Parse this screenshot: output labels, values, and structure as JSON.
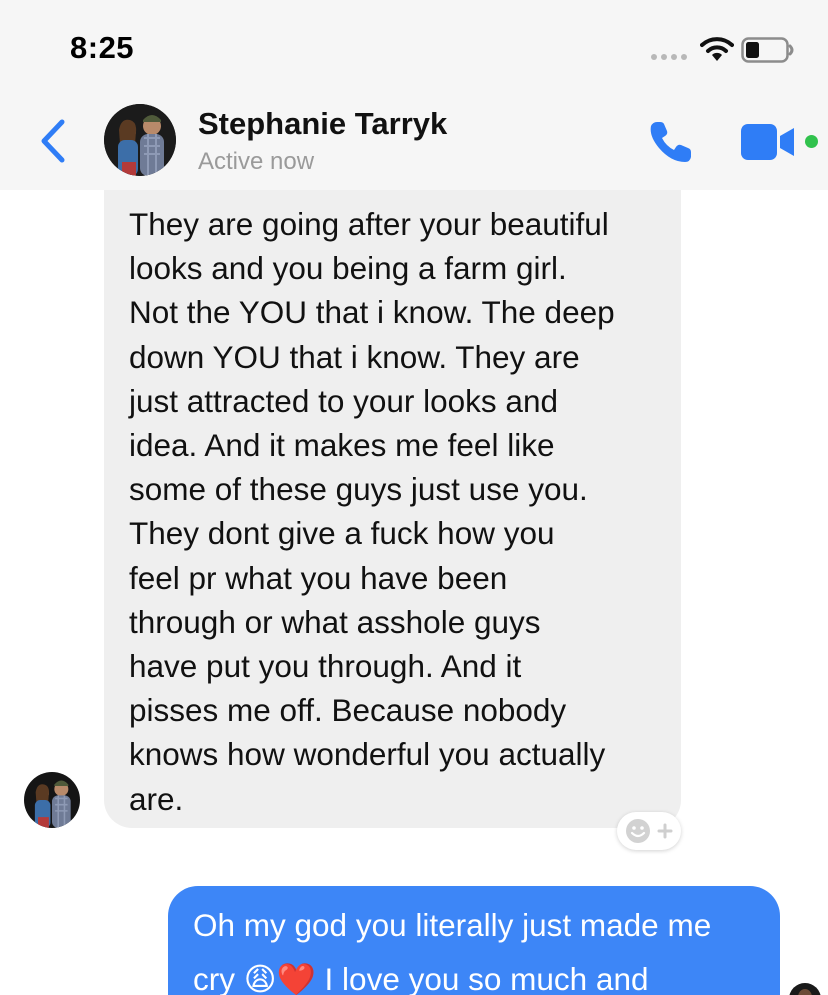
{
  "status_bar": {
    "time": "8:25",
    "icons": [
      "signal-dots-icon",
      "wifi-icon",
      "battery-icon"
    ]
  },
  "header": {
    "back_icon": "chevron-left-icon",
    "contact_name": "Stephanie Tarryk",
    "contact_status": "Active now",
    "call_icon": "phone-icon",
    "video_icon": "video-camera-icon",
    "active_indicator_color": "#31c24d"
  },
  "messages": [
    {
      "direction": "incoming",
      "text": "They are going after your beautiful\nlooks and you being a farm girl.\nNot the YOU that i know. The deep\ndown YOU that i know. They are\njust attracted to your looks and\nidea. And it makes me feel like\nsome of these guys just use you.\nThey dont give a fuck how you\nfeel pr what you have been\nthrough or what asshole guys\nhave put you through. And it\npisses me off. Because nobody\nknows how wonderful you actually\nare."
    },
    {
      "direction": "outgoing",
      "text": "Oh my god you literally just made me\ncry 😩❤️ I love you so much and"
    }
  ],
  "reaction_button_icon": "add-reaction-icon",
  "colors": {
    "accent": "#3d86f7",
    "incoming_bubble": "#efefef",
    "header_background": "#f6f6f6",
    "icon_blue": "#2f7df6"
  }
}
